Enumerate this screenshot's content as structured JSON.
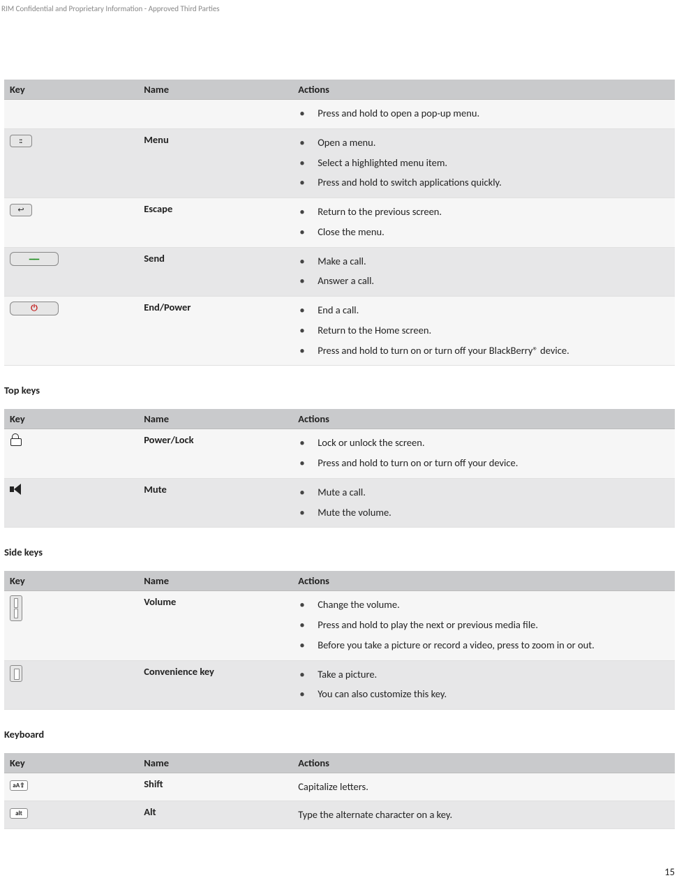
{
  "rim_header": "RIM Confidential and Proprietary Information - Approved Third Parties",
  "page_number": "15",
  "colhead": {
    "key": "Key",
    "name": "Name",
    "actions": "Actions"
  },
  "heading_top": "Top keys",
  "heading_side": "Side keys",
  "heading_keyboard": "Keyboard",
  "t1": [
    {
      "key_icon": "",
      "name": "",
      "actions": [
        "Press and hold to open a pop-up menu."
      ]
    },
    {
      "key_icon": "menu",
      "name": "Menu",
      "actions": [
        "Open a menu.",
        "Select a highlighted menu item.",
        "Press and hold to switch applications quickly."
      ]
    },
    {
      "key_icon": "escape",
      "name": "Escape",
      "actions": [
        "Return to the previous screen.",
        "Close the menu."
      ]
    },
    {
      "key_icon": "send",
      "name": "Send",
      "actions": [
        "Make a call.",
        "Answer a call."
      ]
    },
    {
      "key_icon": "endpower",
      "name": "End/Power",
      "actions": [
        "End a call.",
        "Return to the Home screen.",
        "Press and hold to turn on or turn off your BlackBerry® device."
      ]
    }
  ],
  "t2": [
    {
      "key_icon": "lock",
      "name": "Power/Lock",
      "actions": [
        "Lock or unlock the screen.",
        "Press and hold to turn on or turn off your device."
      ]
    },
    {
      "key_icon": "mute",
      "name": "Mute",
      "actions": [
        "Mute a call.",
        "Mute the volume."
      ]
    }
  ],
  "t3": [
    {
      "key_icon": "volume",
      "name": "Volume",
      "actions": [
        "Change the volume.",
        "Press and hold to play the next or previous media file.",
        "Before you take a picture or record a video, press to zoom in or out."
      ]
    },
    {
      "key_icon": "convenience",
      "name": "Convenience key",
      "actions": [
        "Take a picture.",
        "You can also customize this key."
      ]
    }
  ],
  "t4": [
    {
      "key_icon": "shift",
      "name": "Shift",
      "action_text": "Capitalize letters."
    },
    {
      "key_icon": "alt",
      "name": "Alt",
      "action_text": "Type the alternate character on a key."
    }
  ]
}
